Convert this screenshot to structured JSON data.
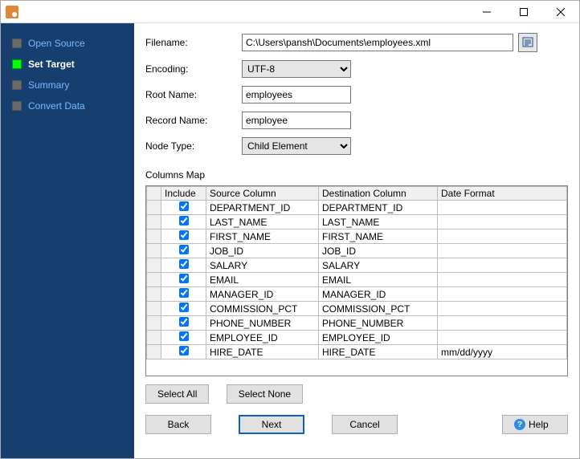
{
  "sidebar": {
    "items": [
      {
        "label": "Open Source"
      },
      {
        "label": "Set Target"
      },
      {
        "label": "Summary"
      },
      {
        "label": "Convert Data"
      }
    ],
    "activeIndex": 1
  },
  "form": {
    "filenameLabel": "Filename:",
    "filenameValue": "C:\\Users\\pansh\\Documents\\employees.xml",
    "encodingLabel": "Encoding:",
    "encodingValue": "UTF-8",
    "rootLabel": "Root Name:",
    "rootValue": "employees",
    "recordLabel": "Record Name:",
    "recordValue": "employee",
    "nodeTypeLabel": "Node Type:",
    "nodeTypeValue": "Child Element"
  },
  "columnsMapLabel": "Columns Map",
  "gridHeaders": {
    "include": "Include",
    "source": "Source Column",
    "dest": "Destination Column",
    "date": "Date Format"
  },
  "rows": [
    {
      "include": true,
      "src": "DEPARTMENT_ID",
      "dest": "DEPARTMENT_ID",
      "date": ""
    },
    {
      "include": true,
      "src": "LAST_NAME",
      "dest": "LAST_NAME",
      "date": ""
    },
    {
      "include": true,
      "src": "FIRST_NAME",
      "dest": "FIRST_NAME",
      "date": ""
    },
    {
      "include": true,
      "src": "JOB_ID",
      "dest": "JOB_ID",
      "date": ""
    },
    {
      "include": true,
      "src": "SALARY",
      "dest": "SALARY",
      "date": ""
    },
    {
      "include": true,
      "src": "EMAIL",
      "dest": "EMAIL",
      "date": ""
    },
    {
      "include": true,
      "src": "MANAGER_ID",
      "dest": "MANAGER_ID",
      "date": ""
    },
    {
      "include": true,
      "src": "COMMISSION_PCT",
      "dest": "COMMISSION_PCT",
      "date": ""
    },
    {
      "include": true,
      "src": "PHONE_NUMBER",
      "dest": "PHONE_NUMBER",
      "date": ""
    },
    {
      "include": true,
      "src": "EMPLOYEE_ID",
      "dest": "EMPLOYEE_ID",
      "date": ""
    },
    {
      "include": true,
      "src": "HIRE_DATE",
      "dest": "HIRE_DATE",
      "date": "mm/dd/yyyy"
    }
  ],
  "buttons": {
    "selectAll": "Select All",
    "selectNone": "Select None",
    "back": "Back",
    "next": "Next",
    "cancel": "Cancel",
    "help": "Help"
  }
}
